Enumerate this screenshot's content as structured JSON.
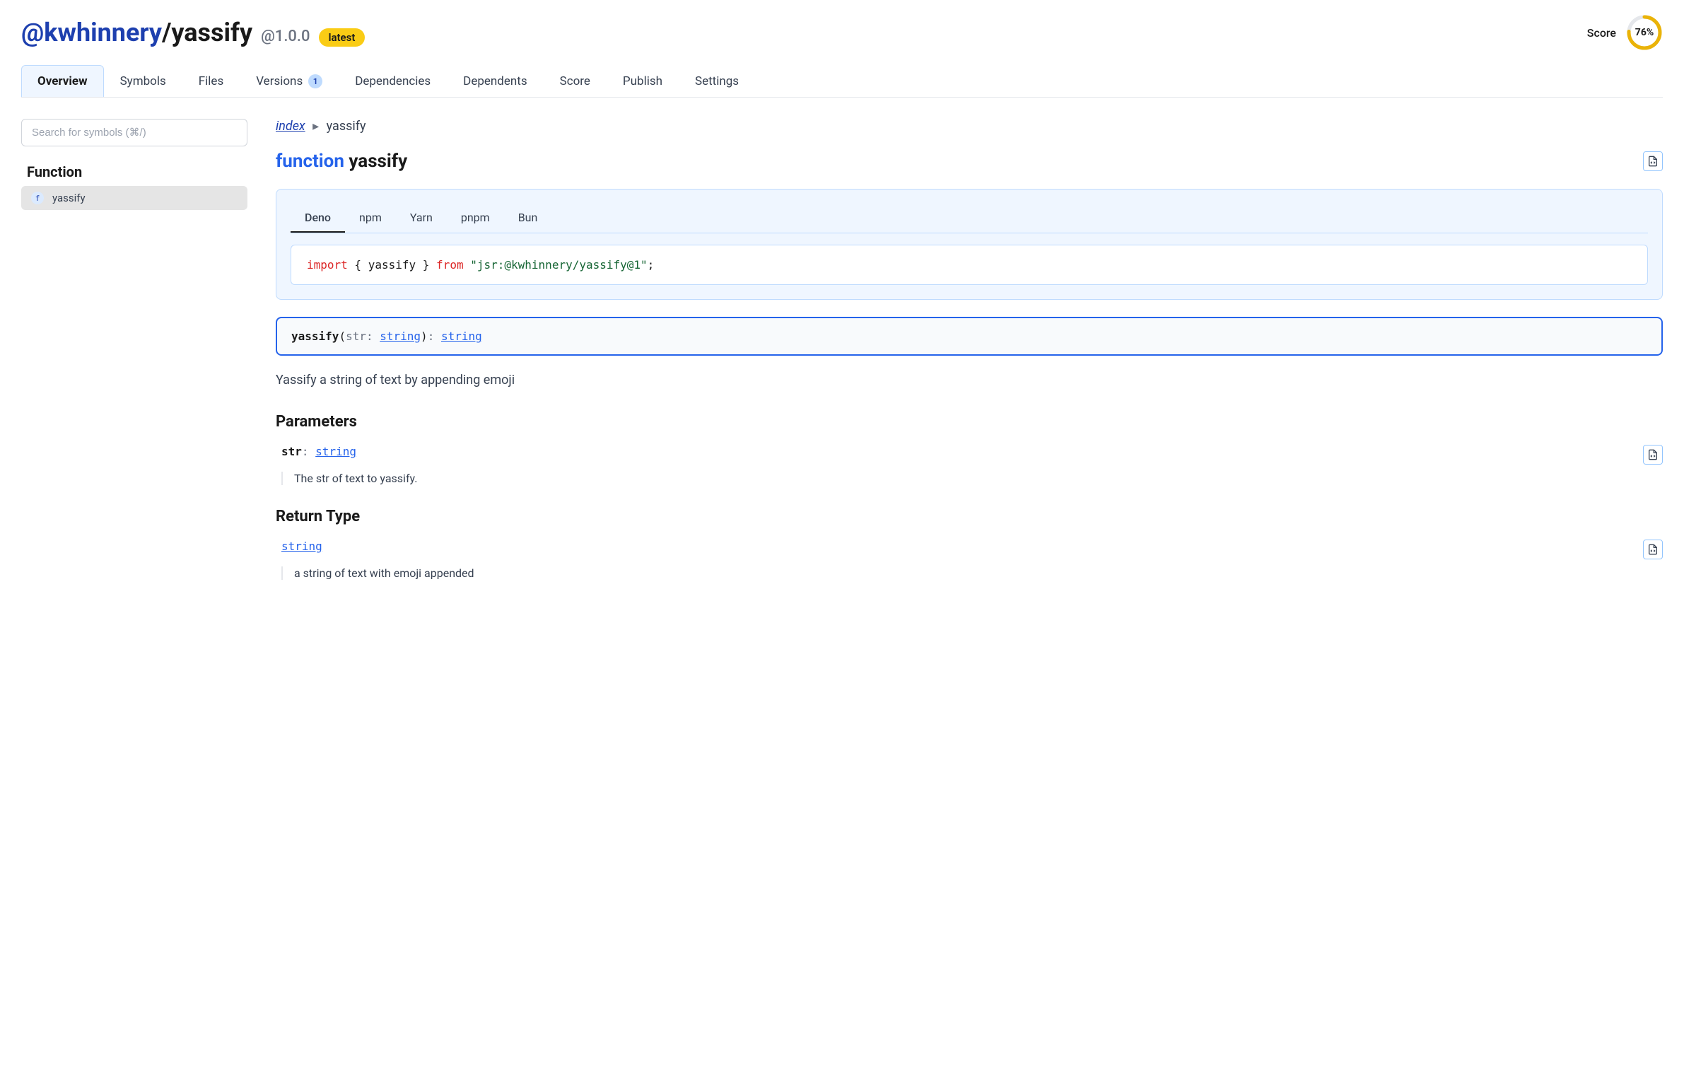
{
  "header": {
    "scope": "@kwhinnery",
    "name": "yassify",
    "version": "@1.0.0",
    "latest_badge": "latest",
    "score_label": "Score",
    "score_value": "76%",
    "score_percent": 76
  },
  "tabs": [
    {
      "label": "Overview",
      "active": true
    },
    {
      "label": "Symbols",
      "active": false
    },
    {
      "label": "Files",
      "active": false
    },
    {
      "label": "Versions",
      "active": false,
      "badge": "1"
    },
    {
      "label": "Dependencies",
      "active": false
    },
    {
      "label": "Dependents",
      "active": false
    },
    {
      "label": "Score",
      "active": false
    },
    {
      "label": "Publish",
      "active": false
    },
    {
      "label": "Settings",
      "active": false
    }
  ],
  "sidebar": {
    "search_placeholder": "Search for symbols (⌘/)",
    "heading": "Function",
    "symbols": [
      {
        "tag": "f",
        "name": "yassify"
      }
    ]
  },
  "breadcrumb": {
    "index": "index",
    "sep": "▸",
    "current": "yassify"
  },
  "symbol": {
    "keyword": "function",
    "name": "yassify"
  },
  "code_tabs": [
    {
      "label": "Deno",
      "active": true
    },
    {
      "label": "npm",
      "active": false
    },
    {
      "label": "Yarn",
      "active": false
    },
    {
      "label": "pnpm",
      "active": false
    },
    {
      "label": "Bun",
      "active": false
    }
  ],
  "code": {
    "import_kw": "import",
    "braces_open": " { ",
    "symbol": "yassify",
    "braces_close": " } ",
    "from_kw": "from",
    "string": "\"jsr:@kwhinnery/yassify@1\"",
    "semi": ";"
  },
  "signature": {
    "name": "yassify",
    "open": "(",
    "param": "str",
    "colon": ": ",
    "param_type": "string",
    "close": ")",
    "ret_colon": ": ",
    "ret_type": "string"
  },
  "description": "Yassify a string of text by appending emoji",
  "parameters": {
    "heading": "Parameters",
    "items": [
      {
        "name": "str",
        "colon": ": ",
        "type": "string",
        "desc": "The str of text to yassify."
      }
    ]
  },
  "return_type": {
    "heading": "Return Type",
    "type": "string",
    "desc": "a string of text with emoji appended"
  }
}
